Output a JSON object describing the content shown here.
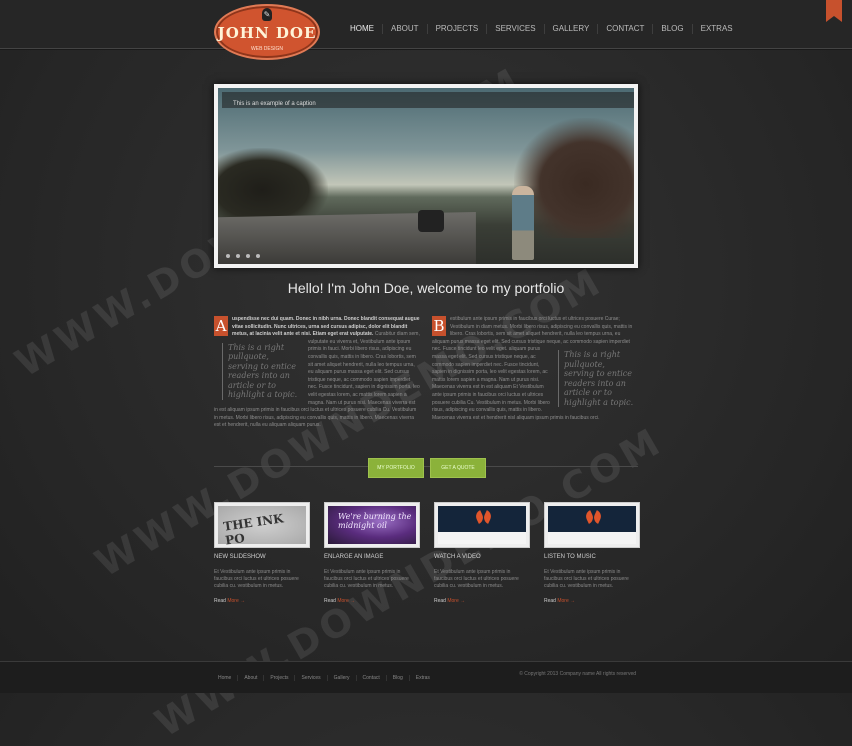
{
  "header": {
    "logo_name": "JOHN DOE",
    "logo_tagline": "WEB DESIGN",
    "nav": [
      "HOME",
      "ABOUT",
      "PROJECTS",
      "SERVICES",
      "GALLERY",
      "CONTACT",
      "BLOG",
      "EXTRAS"
    ]
  },
  "slider": {
    "caption": "This is an example of a caption",
    "dots": 4
  },
  "welcome": "Hello! I'm John Doe, welcome to my portfolio",
  "columns": [
    {
      "drop_cap": "A",
      "lead": "uspendisse nec dui quam. Donec in nibh urna. Donec blandit consequat augue vitae sollicitudin. Nunc ultrices, urna sed cursus adipisc, dolor elit blandit metus, at lacinia velit ante et nisi. Etiam eget erat vulputate.",
      "pull_quote": "This is a right pullquote, serving to entice readers into an article or to highlight a topic.",
      "body": "Curabitur diam sem, vulputate eu viverra et, Vestibulum ante ipsum primis in fauci. Morbi libero risus, adipiscing eu convallis quis, mattis in libero. Cras lobortis, sem sit amet aliquet hendrerit, nulla leo tempus urna, eu aliquam purus massa eget elit. Sed cursus tristique neque, ac commodo sapien imperdiet nec. Fusce tincidunt, sapien in dignissim porta, leo velit egestas lorem, ac mattis lorem sapien a magna. Nam ut purus nisi. Maecenas viverra est in est aliquam ipsum primis in faucibus orci luctus et ultrices posuere cubilia Cu. Vestibulum in metus. Morbi libero risus, adipiscing eu convallis quis, mattis in libero. Maecenas viverra est et hendrerit, nulla eu aliquam aliquam purus."
    },
    {
      "drop_cap": "B",
      "lead": "estibulum ante ipsum primis in faucibus orci luctus et ultrices posuere Curae; Vestibulum in diam metus. Morbi libero risus, adipiscing eu convallis quis, mattis in libero. Cras lobortis, sem sit amet aliquet hendrerit, nulla leo tempus urna, eu aliquam purus massa eget elit. Sed cursus tristique neque, ac commodo sapien imperdiet nec. Fusce tincidunt leo velit eget.",
      "pull_quote": "This is a right pullquote, serving to entice readers into an article or to highlight a topic.",
      "body": "aliquam purus massa eget elit. Sed cursus tristique neque, ac commodo sapien imperdiet nec. Fusce tincidunt, sapien in dignissim porta, leo velit egestas lorem, ac mattis lorem sapien a magna. Nam ut purus nisi. Maecenas viverra est in est aliquam Et Vestibulum ante ipsum primis in faucibus orci luctus et ultrices posuere cubilia Cu. Vestibulum in metus. Morbi libero risus, adipiscing eu convallis quis, mattis in libero. Maecenas viverra est et hendrerit nisl aliquam ipsum primis in faucibus orci."
    }
  ],
  "buttons": [
    "MY PORTFOLIO",
    "GET A QUOTE"
  ],
  "features": [
    {
      "title": "NEW SLIDESHOW",
      "text": "Et Vestibulum ante ipsum primis in faucibus orci luctus et ultrices posuere cubilia cu. vestibulum in metus.",
      "read": "Read",
      "more": "More",
      "thumb": "THE INK PO"
    },
    {
      "title": "ENLARGE AN IMAGE",
      "text": "Et Vestibulum ante ipsum primis in faucibus orci luctus et ultrices posuere cubilia cu. vestibulum in metus.",
      "read": "Read",
      "more": "More",
      "thumb": "We're burning the midnight oil"
    },
    {
      "title": "WATCH A VIDEO",
      "text": "Et Vestibulum ante ipsum primis in faucibus orci luctus et ultrices posuere cubilia cu. vestibulum in metus.",
      "read": "Read",
      "more": "More",
      "thumb": ""
    },
    {
      "title": "LISTEN TO MUSIC",
      "text": "Et Vestibulum ante ipsum primis in faucibus orci luctus et ultrices posuere cubilia cu. vestibulum in metus.",
      "read": "Read",
      "more": "More",
      "thumb": ""
    }
  ],
  "footer": {
    "nav": [
      "Home",
      "About",
      "Projects",
      "Services",
      "Gallery",
      "Contact",
      "Blog",
      "Extras"
    ],
    "copyright": "© Copyright 2013 Company name All rights reserved"
  },
  "watermark": "WWW.DOWNDEMO.COM",
  "colors": {
    "accent": "#c7512d",
    "button_green": "#8bb23a",
    "background": "#2b2b2b"
  }
}
